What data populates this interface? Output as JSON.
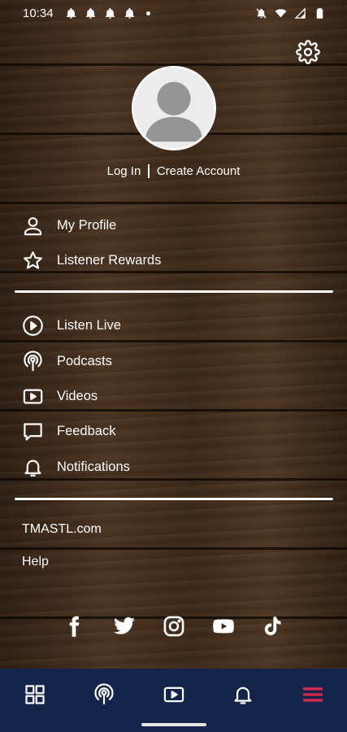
{
  "status_bar": {
    "time": "10:34",
    "notification_icons": [
      "bell-icon",
      "bell-icon",
      "bell-icon",
      "bell-icon"
    ],
    "system_icons": [
      "do-not-disturb-icon",
      "wifi-icon",
      "signal-icon",
      "battery-icon"
    ]
  },
  "header": {
    "settings_icon": "gear-icon",
    "avatar_icon": "user-placeholder-icon"
  },
  "auth": {
    "login_label": "Log In",
    "create_account_label": "Create Account"
  },
  "menu_account": [
    {
      "label": "My Profile",
      "icon": "person-icon"
    },
    {
      "label": "Listener Rewards",
      "icon": "star-icon"
    }
  ],
  "menu_main": [
    {
      "label": "Listen Live",
      "icon": "play-circle-icon"
    },
    {
      "label": "Podcasts",
      "icon": "podcast-icon"
    },
    {
      "label": "Videos",
      "icon": "video-icon"
    },
    {
      "label": "Feedback",
      "icon": "feedback-icon"
    },
    {
      "label": "Notifications",
      "icon": "bell-icon"
    }
  ],
  "links": {
    "website": "TMASTL.com",
    "help": "Help"
  },
  "social": [
    "facebook-icon",
    "twitter-icon",
    "instagram-icon",
    "youtube-icon",
    "tiktok-icon"
  ],
  "bottom_nav": {
    "items": [
      "grid-icon",
      "podcast-icon",
      "video-icon",
      "bell-icon",
      "menu-icon"
    ],
    "active": "menu-icon"
  },
  "colors": {
    "nav_background": "#15244a",
    "active_accent": "#d0284a",
    "text": "#ffffff"
  }
}
